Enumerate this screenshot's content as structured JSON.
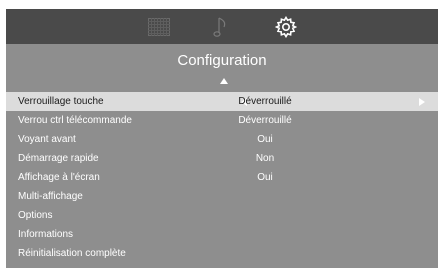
{
  "tabs": [
    {
      "icon": "picture-grid-icon",
      "active": false
    },
    {
      "icon": "music-note-icon",
      "active": false
    },
    {
      "icon": "gear-icon",
      "active": true
    }
  ],
  "title": "Configuration",
  "menu": [
    {
      "label": "Verrouillage touche",
      "value": "Déverrouillé",
      "selected": true
    },
    {
      "label": "Verrou ctrl télécommande",
      "value": "Déverrouillé"
    },
    {
      "label": "Voyant avant",
      "value": "Oui"
    },
    {
      "label": "Démarrage rapide",
      "value": "Non"
    },
    {
      "label": "Affichage à l'écran",
      "value": "Oui"
    },
    {
      "label": "Multi-affichage",
      "value": ""
    },
    {
      "label": "Options",
      "value": ""
    },
    {
      "label": "Informations",
      "value": ""
    },
    {
      "label": "Réinitialisation complète",
      "value": ""
    }
  ],
  "colors": {
    "panel": "#8e8e8e",
    "topbar": "#4a4a4a",
    "selected_row": "#dcdcdc"
  }
}
